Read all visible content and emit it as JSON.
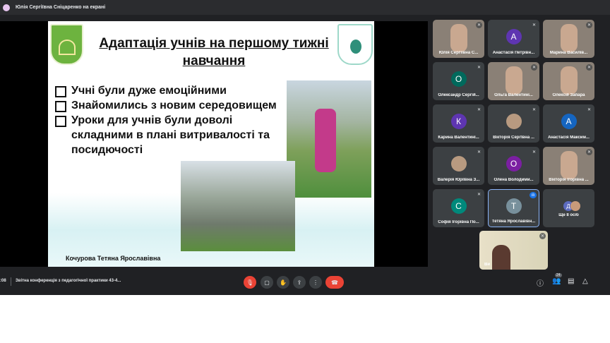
{
  "topbar": {
    "presenter_text": "Юлія Сергіївна Сніцаренко на екрані"
  },
  "slide": {
    "title": "Адаптація учнів на першому тижні навчання",
    "bullets": [
      "Учні були дуже емоційними",
      "Знайомились з новим середовищем",
      "Уроки для учнів були доволі складними в плані витривалості та посидючості"
    ],
    "caption": "Кочурова Тетяна Ярославівна"
  },
  "participants": [
    {
      "name": "Юлія Сергіївна С...",
      "type": "video"
    },
    {
      "name": "Анастасія Петрівн...",
      "initial": "А",
      "color": "#5e35b1"
    },
    {
      "name": "Марина Василів...",
      "type": "video"
    },
    {
      "name": "Олександр Сергій...",
      "initial": "О",
      "color": "#00695c"
    },
    {
      "name": "Ольга Валентині...",
      "type": "video"
    },
    {
      "name": "Олексій Запара",
      "type": "video"
    },
    {
      "name": "Карина Валентині...",
      "initial": "К",
      "color": "#5e35b1"
    },
    {
      "name": "Вікторія СергЇвна ...",
      "type": "photo"
    },
    {
      "name": "Анастасія Максим...",
      "initial": "А",
      "color": "#1565c0"
    },
    {
      "name": "Валерія Юріївна З...",
      "type": "photo"
    },
    {
      "name": "Олена Володими...",
      "initial": "О",
      "color": "#7b1fa2"
    },
    {
      "name": "Вікторія Ігорівна ...",
      "type": "video"
    },
    {
      "name": "Софія Ігорівна По...",
      "initial": "С",
      "color": "#00897b"
    },
    {
      "name": "Тетяна Ярославівн...",
      "initial": "Т",
      "color": "#78909c",
      "speaking": true
    }
  ],
  "more": {
    "label": "Ще 8 осіб",
    "initial": "Д"
  },
  "self": {
    "name": "Ви"
  },
  "bottombar": {
    "clock": ":08",
    "meeting_title": "Звітна конференція з педагогічної практики 43-4...",
    "people_count": "24"
  },
  "colors": {
    "end_call": "#ea4335",
    "speaking": "#1a73e8"
  }
}
